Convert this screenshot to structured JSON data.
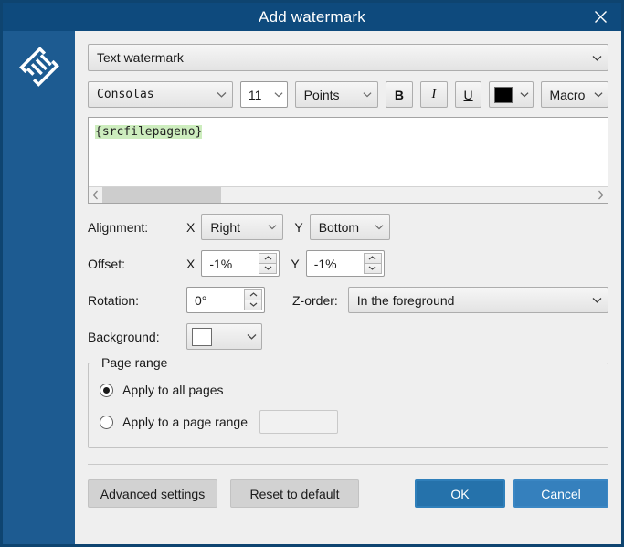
{
  "window": {
    "title": "Add watermark",
    "close_icon": "close-icon",
    "logo_icon": "app-logo-icon",
    "titlebar_color": "#0e4a7d",
    "sidebar_color": "#1d5b91"
  },
  "watermark_type": {
    "label": "Text watermark",
    "chevron_icon": "chevron-down-icon"
  },
  "font_toolbar": {
    "font_family": "Consolas",
    "font_size": "11",
    "size_units": "Points",
    "bold_label": "B",
    "italic_label": "I",
    "underline_label": "U",
    "text_color": "#000000",
    "color_swatch_name": "text-color-swatch",
    "macro_label": "Macro"
  },
  "editor": {
    "text": "{srcfilepageno}",
    "highlight_color": "#cdedbe",
    "scroll_left_icon": "chevron-left-icon",
    "scroll_right_icon": "chevron-right-icon"
  },
  "alignment": {
    "label": "Alignment:",
    "x_axis_label": "X",
    "x_value": "Right",
    "y_axis_label": "Y",
    "y_value": "Bottom"
  },
  "offset": {
    "label": "Offset:",
    "x_axis_label": "X",
    "x_value": "-1%",
    "y_axis_label": "Y",
    "y_value": "-1%"
  },
  "rotation": {
    "label": "Rotation:",
    "value": "0°"
  },
  "zorder": {
    "label": "Z-order:",
    "value": "In the foreground"
  },
  "background": {
    "label": "Background:",
    "color": "#ffffff",
    "swatch_name": "background-color-swatch"
  },
  "page_range": {
    "title": "Page range",
    "option_all": "Apply to all pages",
    "option_range": "Apply to a page range",
    "selected": "all",
    "range_value": ""
  },
  "footer": {
    "advanced_settings": "Advanced settings",
    "reset_to_default": "Reset to default",
    "ok": "OK",
    "cancel": "Cancel",
    "ok_color": "#2572ab",
    "cancel_color": "#3580bd"
  }
}
